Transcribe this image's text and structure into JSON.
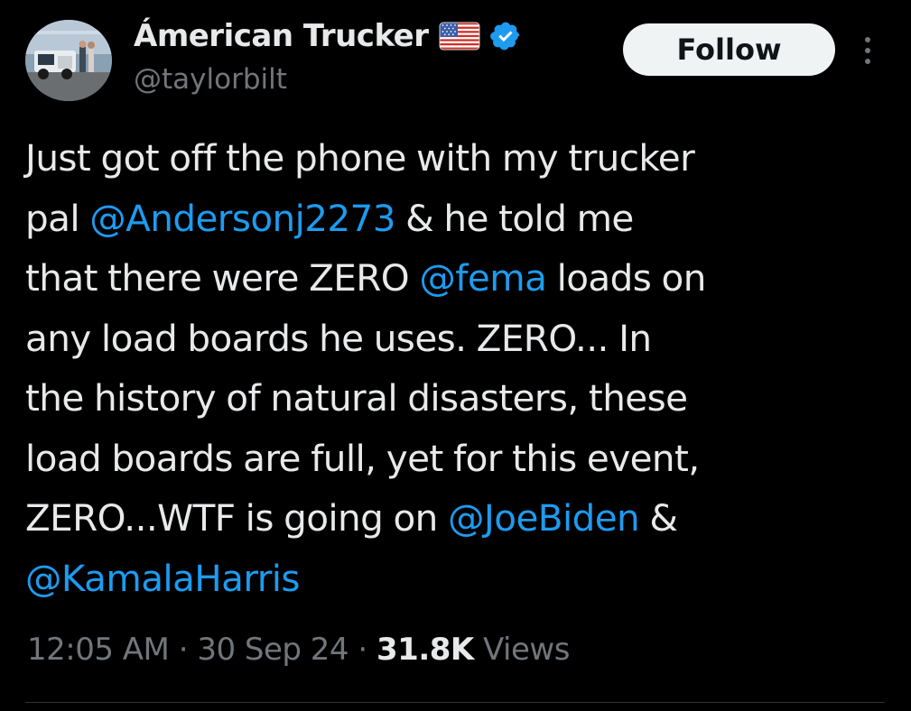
{
  "author": {
    "display_name": "Ámerican Trucker",
    "handle": "@taylorbilt",
    "avatar_icon": "profile-photo-truck",
    "flag_icon": "us-flag-emoji",
    "verified_icon": "verified-badge",
    "verified_color": "#1d9bf0"
  },
  "actions": {
    "follow_label": "Follow",
    "more_icon": "more-vertical-icon"
  },
  "tweet": {
    "lines": [
      [
        {
          "text": "Just got off the phone with my trucker",
          "mention": false
        }
      ],
      [
        {
          "text": "pal ",
          "mention": false
        },
        {
          "text": "@Andersonj2273",
          "mention": true
        },
        {
          "text": " & he told me",
          "mention": false
        }
      ],
      [
        {
          "text": "that there were ZERO ",
          "mention": false
        },
        {
          "text": "@fema",
          "mention": true
        },
        {
          "text": " loads on",
          "mention": false
        }
      ],
      [
        {
          "text": "any load boards he uses. ZERO... In",
          "mention": false
        }
      ],
      [
        {
          "text": "the history of natural disasters, these",
          "mention": false
        }
      ],
      [
        {
          "text": "load boards are full, yet for this event,",
          "mention": false
        }
      ],
      [
        {
          "text": "ZERO...WTF is going on ",
          "mention": false
        },
        {
          "text": "@JoeBiden",
          "mention": true
        },
        {
          "text": " &",
          "mention": false
        }
      ],
      [
        {
          "text": "@KamalaHarris",
          "mention": true
        }
      ]
    ]
  },
  "meta": {
    "time": "12:05 AM",
    "separator": " · ",
    "date": "30 Sep 24",
    "views_count": "31.8K",
    "views_label": " Views"
  },
  "colors": {
    "background": "#000000",
    "text": "#e7e9ea",
    "secondary": "#71767b",
    "link": "#1d9bf0",
    "follow_bg": "#eff3f4"
  }
}
